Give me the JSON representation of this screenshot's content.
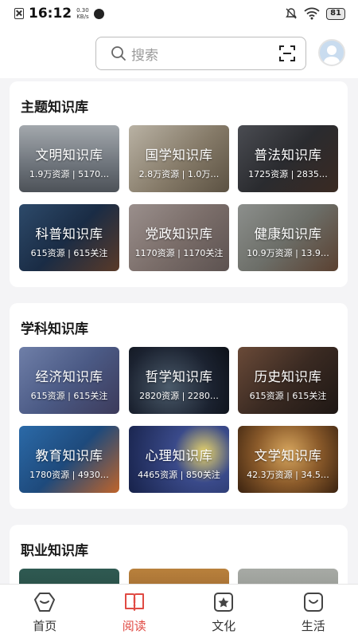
{
  "status_bar": {
    "time": "16:12",
    "speed_value": "0.30",
    "speed_unit": "KB/s",
    "battery": "81"
  },
  "search": {
    "placeholder": "搜索"
  },
  "sections": [
    {
      "title": "主题知识库"
    },
    {
      "title": "学科知识库"
    },
    {
      "title": "职业知识库"
    }
  ],
  "theme_tiles": [
    {
      "name": "文明知识库",
      "stats": "1.9万资源 | 5170…"
    },
    {
      "name": "国学知识库",
      "stats": "2.8万资源 | 1.0万…"
    },
    {
      "name": "普法知识库",
      "stats": "1725资源 | 2835…"
    },
    {
      "name": "科普知识库",
      "stats": "615资源 | 615关注"
    },
    {
      "name": "党政知识库",
      "stats": "1170资源 | 1170关注"
    },
    {
      "name": "健康知识库",
      "stats": "10.9万资源 | 13.9…"
    }
  ],
  "subject_tiles": [
    {
      "name": "经济知识库",
      "stats": "615资源 | 615关注"
    },
    {
      "name": "哲学知识库",
      "stats": "2820资源 | 2280…"
    },
    {
      "name": "历史知识库",
      "stats": "615资源 | 615关注"
    },
    {
      "name": "教育知识库",
      "stats": "1780资源 | 4930…"
    },
    {
      "name": "心理知识库",
      "stats": "4465资源 | 850关注"
    },
    {
      "name": "文学知识库",
      "stats": "42.3万资源 | 34.5…"
    }
  ],
  "nav": [
    {
      "label": "首页",
      "icon": "home-icon"
    },
    {
      "label": "阅读",
      "icon": "book-icon"
    },
    {
      "label": "文化",
      "icon": "culture-icon"
    },
    {
      "label": "生活",
      "icon": "life-icon"
    }
  ],
  "colors": {
    "accent": "#e04a43",
    "background": "#f4f4f6"
  }
}
